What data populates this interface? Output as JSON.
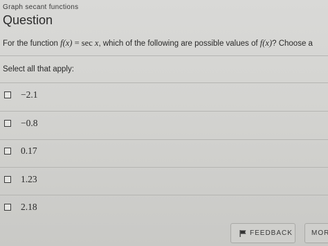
{
  "header": {
    "topic": "Graph secant functions",
    "heading": "Question"
  },
  "prompt": {
    "lead": "For the function ",
    "func": "f(x)",
    "equals": " = ",
    "rhs_sec": "sec ",
    "rhs_var": "x",
    "middle": ", which of the following are possible values of ",
    "func2": "f(x)",
    "tail": "? Choose a"
  },
  "select_all_label": "Select all that apply:",
  "options": [
    {
      "label": "−2.1",
      "checked": false
    },
    {
      "label": "−0.8",
      "checked": false
    },
    {
      "label": "0.17",
      "checked": false
    },
    {
      "label": "1.23",
      "checked": false
    },
    {
      "label": "2.18",
      "checked": false
    }
  ],
  "footer": {
    "feedback_label": "FEEDBACK",
    "feedback_icon": "flag-icon",
    "more_label": "MOR"
  },
  "colors": {
    "background": "#d4d4d1",
    "text": "#2a2a2a",
    "rule": "#b5b5b2"
  }
}
